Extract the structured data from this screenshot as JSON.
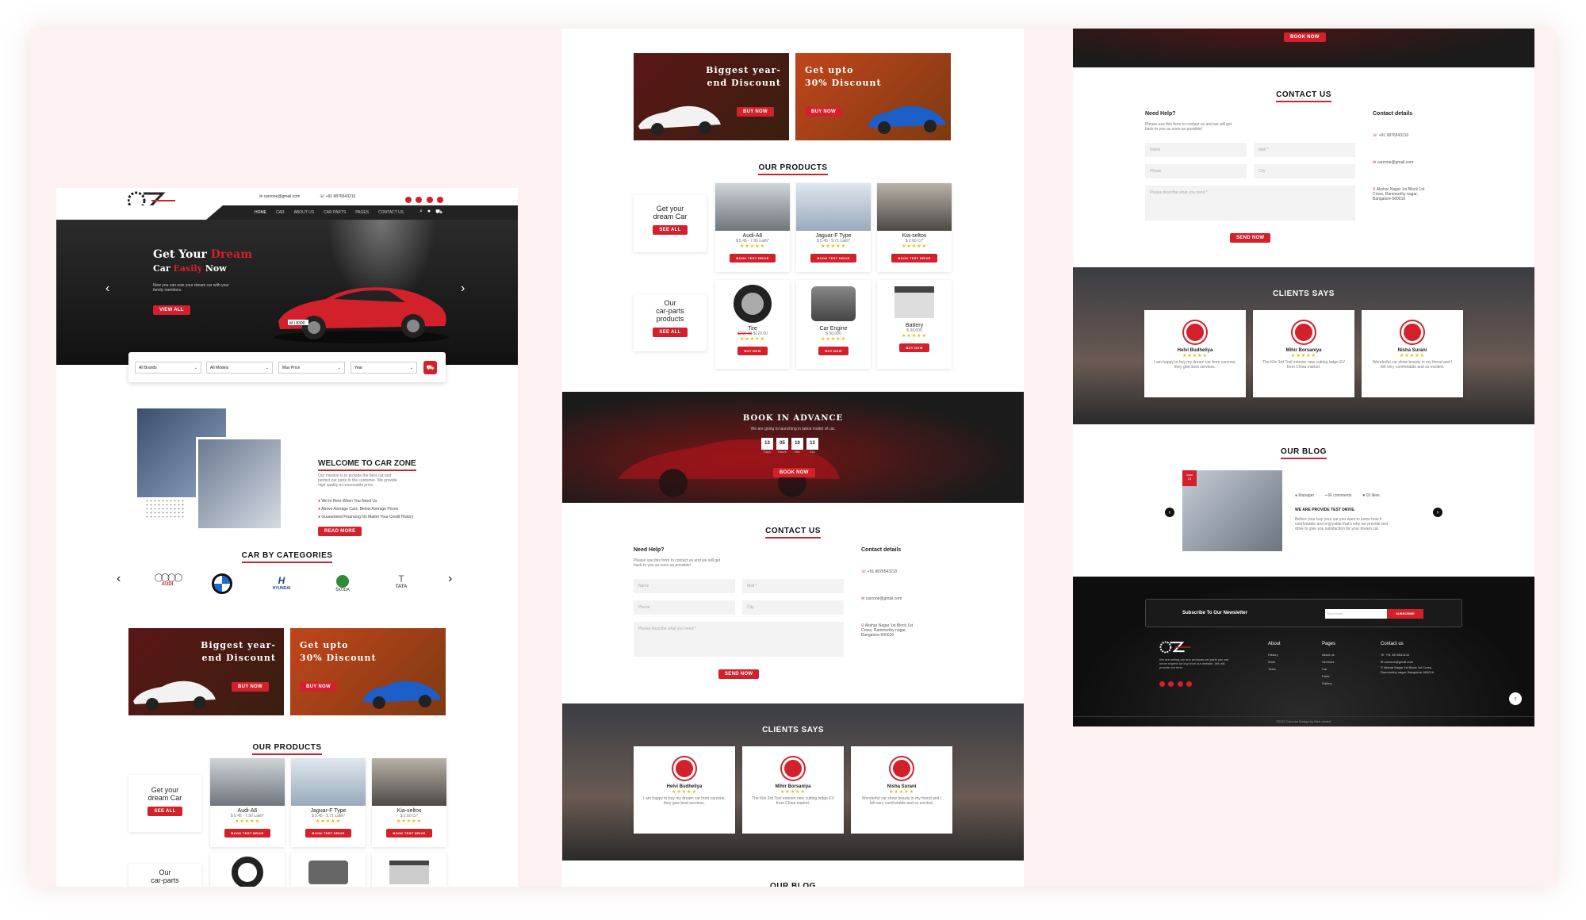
{
  "header": {
    "email": "carzone@gmail.com",
    "phone": "+91 9876543210",
    "nav": [
      "HOME",
      "CAR",
      "ABOUT US",
      "CAR PARTS",
      "PAGES",
      "CONTACT US"
    ]
  },
  "hero": {
    "line1a": "Get Your ",
    "line1b": "Dream",
    "line2a": "Car ",
    "line2b": "Easily",
    "line2c": " Now",
    "desc": "Now you can own your dream car with your family members.",
    "button": "VIEW ALL",
    "plate": "M I 8300"
  },
  "search": {
    "brands": "All Brands",
    "models": "All Models",
    "price": "Max Price",
    "year": "Year"
  },
  "welcome": {
    "title": "WELCOME TO CAR ZONE",
    "text": "Our mission is to provide the best car and perfect car parts to the customer. We provide high quality at reasonable price.",
    "bullets": [
      "We're Here When You Need Us",
      "Above Average Cars, Below Average Prices",
      "Guaranteed Financing No Matter Your Credit History"
    ],
    "button": "READ MORE"
  },
  "categories": {
    "title": "CAR BY CATEGORIES",
    "brands": [
      "AUDI",
      "BMW",
      "HYUNDAI",
      "ŠKODA",
      "TATA"
    ]
  },
  "promos": [
    {
      "line1": "Biggest year-",
      "line2": "end Discount",
      "button": "BUY NOW"
    },
    {
      "line1": "Get upto",
      "line2": "30% Discount",
      "button": "BUY NOW"
    }
  ],
  "products": {
    "title": "OUR PRODUCTS",
    "cars_label_1": "Get your",
    "cars_label_2": "dream Car",
    "parts_label_1": "Our",
    "parts_label_2": "car-parts",
    "parts_label_3": "products",
    "see_all": "SEE ALL",
    "cars": [
      {
        "name": "Audi-A6",
        "price": "$ 5.45 - 7.90 Lakh*",
        "button": "BOOK TEST DRIVE"
      },
      {
        "name": "Jaguar-F Type",
        "price": "$ 5.45 - 9.71 Lakh*",
        "button": "BOOK TEST DRIVE"
      },
      {
        "name": "Kia-seltos",
        "price": "$ 2.60 Cr*",
        "button": "BOOK TEST DRIVE"
      }
    ],
    "parts": [
      {
        "name": "Tire",
        "old_price": "$200.00",
        "price": "$170.00",
        "button": "BUY NOW"
      },
      {
        "name": "Car Engine",
        "price": "$ 50,000",
        "button": "BUY NOW"
      },
      {
        "name": "Battery",
        "price": "$ 36,000",
        "button": "BUY NOW"
      }
    ],
    "parts_price_right": "$ 2.60 Cr*",
    "audi_price_alt": "$ 5.45 - 7.90 Lakh*"
  },
  "booking": {
    "title": "BOOK IN ADVANCE",
    "subtitle": "We are going to launching in latest model of car.",
    "counts": [
      {
        "value": "13",
        "label": "Days"
      },
      {
        "value": "05",
        "label": "Hours"
      },
      {
        "value": "10",
        "label": "Min"
      },
      {
        "value": "12",
        "label": "Sec"
      }
    ],
    "button": "BOOK NOW"
  },
  "contact": {
    "title": "CONTACT US",
    "need_help": "Need Help?",
    "help_text": "Please use this form to contact us and we will get back to you as soon as possible!",
    "fields": [
      "Name",
      "Mail *",
      "Phone",
      "City"
    ],
    "message": "Please describe what you need *",
    "button": "SEND NOW",
    "details_title": "Contact details",
    "phone": "+91 9876543210",
    "email": "carzone@gmail.com",
    "address": "Akshar Nagar 1st Block 1st Cross, Rammurthy nagar, Bangalore-560016"
  },
  "clients": {
    "title": "CLIENTS SAYS",
    "items": [
      {
        "name": "Helvi Budheliya",
        "text": "I am happy to buy my dream car from carzone, they give best services."
      },
      {
        "name": "Mihir Borsaniya",
        "text": "The Kilo 3rd Tool exterior new cutting ledge EV from China market."
      },
      {
        "name": "Nisha Surani",
        "text": "Wonderful car show beauty in my friend and I felt very comfortable and so excited."
      }
    ]
  },
  "blog": {
    "title": "OUR BLOG",
    "date_day": "June",
    "date_num": "15",
    "author": "Manager",
    "comments": "66 comments",
    "likes": "03 likes",
    "post_title": "WE ARE PROVIDE TEST DRIVE.",
    "post_text": "Before your buy your car you want to know how it comfortable and enjoyable that's why we provide test drive to give you satisfaction for your dream car."
  },
  "footer": {
    "newsletter": "Subscribe To Our Newsletter",
    "email_placeholder": "Your email",
    "subscribe": "SUBSCRIBE",
    "about_text": "We are selling car and products car parts you are never regrets for buy from our website. We will provide our best.",
    "cols": [
      {
        "title": "About",
        "items": [
          "History",
          "Work",
          "Team"
        ]
      },
      {
        "title": "Pages",
        "items": [
          "About us",
          "Services",
          "Car",
          "Parts",
          "Gallery"
        ]
      },
      {
        "title": "Contact us",
        "items": [
          "+91 9876543210",
          "carzone@gmail.com",
          "Akshar Nagar 1st Block 1st Cross, Rammurthy nagar, Bangalore-560016"
        ]
      }
    ],
    "copyright": "©2022 Carzone Design by Web creater"
  },
  "colors": {
    "accent": "#d3212c",
    "dark": "#1b1b1b",
    "bg": "#fdf1f1"
  }
}
